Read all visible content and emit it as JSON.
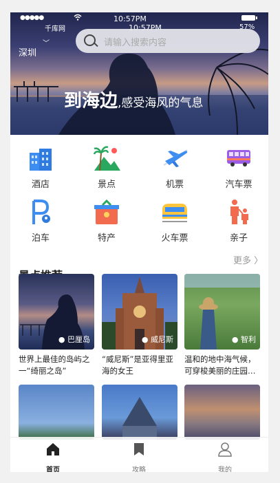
{
  "status": {
    "signal": "●●●●●",
    "carrier": "千库网",
    "wifi": "wifi",
    "time": "10:57PM",
    "time_overlay": "10:57PM",
    "battery": "57%"
  },
  "header": {
    "city": "深圳",
    "chevron": "﹀",
    "search_placeholder": "请输入搜索内容"
  },
  "hero": {
    "title_big": "到海边",
    "title_small": ",感受海风的气息"
  },
  "categories": [
    {
      "label": "酒店",
      "icon": "hotel-icon"
    },
    {
      "label": "景点",
      "icon": "scenic-icon"
    },
    {
      "label": "机票",
      "icon": "plane-icon"
    },
    {
      "label": "汽车票",
      "icon": "bus-icon"
    },
    {
      "label": "泊车",
      "icon": "parking-icon"
    },
    {
      "label": "特产",
      "icon": "specialty-icon"
    },
    {
      "label": "火车票",
      "icon": "train-icon"
    },
    {
      "label": "亲子",
      "icon": "family-icon"
    }
  ],
  "section": {
    "title": "景点推荐",
    "more": "更多 〉"
  },
  "cards": [
    {
      "location": "巴厘岛",
      "desc": "世界上最佳的岛屿之一“绮丽之岛”"
    },
    {
      "location": "威尼斯",
      "desc": "“威尼斯”是亚得里亚海的女王"
    },
    {
      "location": "智利",
      "desc": "温和的地中海气候，可穿梭美丽的庄园…"
    }
  ],
  "tabs": [
    {
      "label": "首页",
      "icon": "home-icon"
    },
    {
      "label": "攻略",
      "icon": "bookmark-icon"
    },
    {
      "label": "我的",
      "icon": "user-icon"
    }
  ]
}
